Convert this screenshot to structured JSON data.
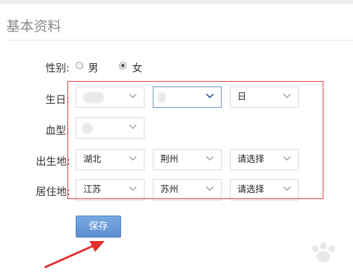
{
  "header": {
    "section_title": "基本资料"
  },
  "gender": {
    "label": "性别:",
    "options": [
      {
        "label": "男",
        "checked": false
      },
      {
        "label": "女",
        "checked": true
      }
    ]
  },
  "birthday": {
    "label": "生日:",
    "year_value": "",
    "month_value": "",
    "day_value": "日"
  },
  "blood_type": {
    "label": "血型:",
    "value": ""
  },
  "birthplace": {
    "label": "出生地:",
    "province": "湖北",
    "city": "荆州",
    "district": "请选择"
  },
  "residence": {
    "label": "居住地:",
    "province": "江苏",
    "city": "苏州",
    "district": "请选择"
  },
  "actions": {
    "save_label": "保存"
  },
  "annotation": {
    "highlight_color": "#dd3b3b"
  }
}
